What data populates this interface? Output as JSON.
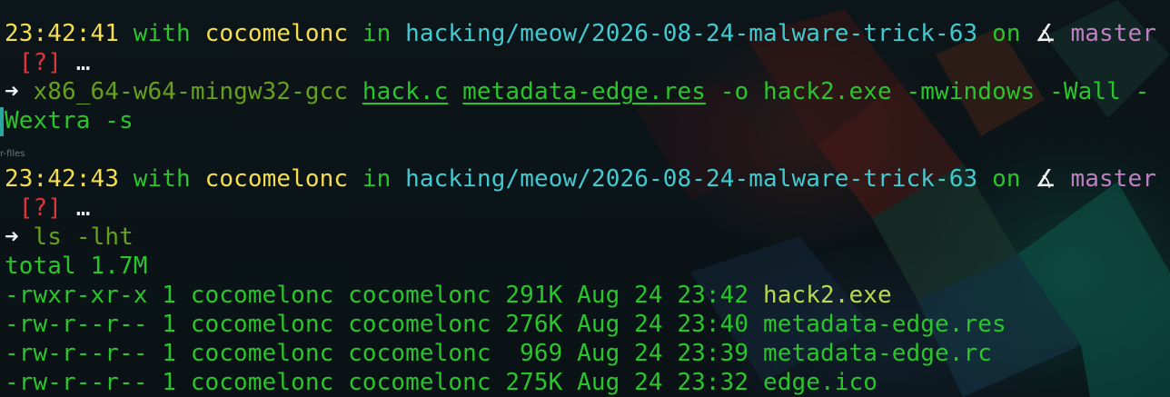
{
  "colors": {
    "background": "#0b1418",
    "time": "#f4de4f",
    "keyword": "#29c52b",
    "user": "#f4de4f",
    "path": "#40cbd1",
    "branch": "#c07fc2",
    "status": "#e0353a",
    "command": "#66a01c",
    "output": "#29c52b"
  },
  "prompt1": {
    "time": "23:42:41",
    "with": "with",
    "user": "cocomelonc",
    "in": "in",
    "path": "hacking/meow/2026-08-24-malware-trick-63",
    "on": "on",
    "branch_icon": "∡",
    "branch": "master",
    "status": "[?]",
    "ellipsis": "…"
  },
  "command1": {
    "arrow": "➜",
    "program": "x86_64-w64-mingw32-gcc",
    "file1": "hack.c",
    "file2": "metadata-edge.res",
    "rest_line1": "-o hack2.exe -mwindows -Wall -",
    "rest_line2": "Wextra -s"
  },
  "side_label": "r-files",
  "prompt2": {
    "time": "23:42:43",
    "with": "with",
    "user": "cocomelonc",
    "in": "in",
    "path": "hacking/meow/2026-08-24-malware-trick-63",
    "on": "on",
    "branch_icon": "∡",
    "branch": "master",
    "status": "[?]",
    "ellipsis": "…"
  },
  "command2": {
    "arrow": "➜",
    "program": "ls",
    "args": "-lht"
  },
  "listing": {
    "total": "total 1.7M",
    "rows": [
      {
        "meta": "-rwxr-xr-x 1 cocomelonc cocomelonc 291K Aug 24 23:42 ",
        "name": "hack2.exe"
      },
      {
        "meta": "-rw-r--r-- 1 cocomelonc cocomelonc 276K Aug 24 23:40 ",
        "name": "metadata-edge.res"
      },
      {
        "meta": "-rw-r--r-- 1 cocomelonc cocomelonc  969 Aug 24 23:39 ",
        "name": "metadata-edge.rc"
      },
      {
        "meta": "-rw-r--r-- 1 cocomelonc cocomelonc 275K Aug 24 23:32 ",
        "name": "edge.ico"
      }
    ]
  }
}
